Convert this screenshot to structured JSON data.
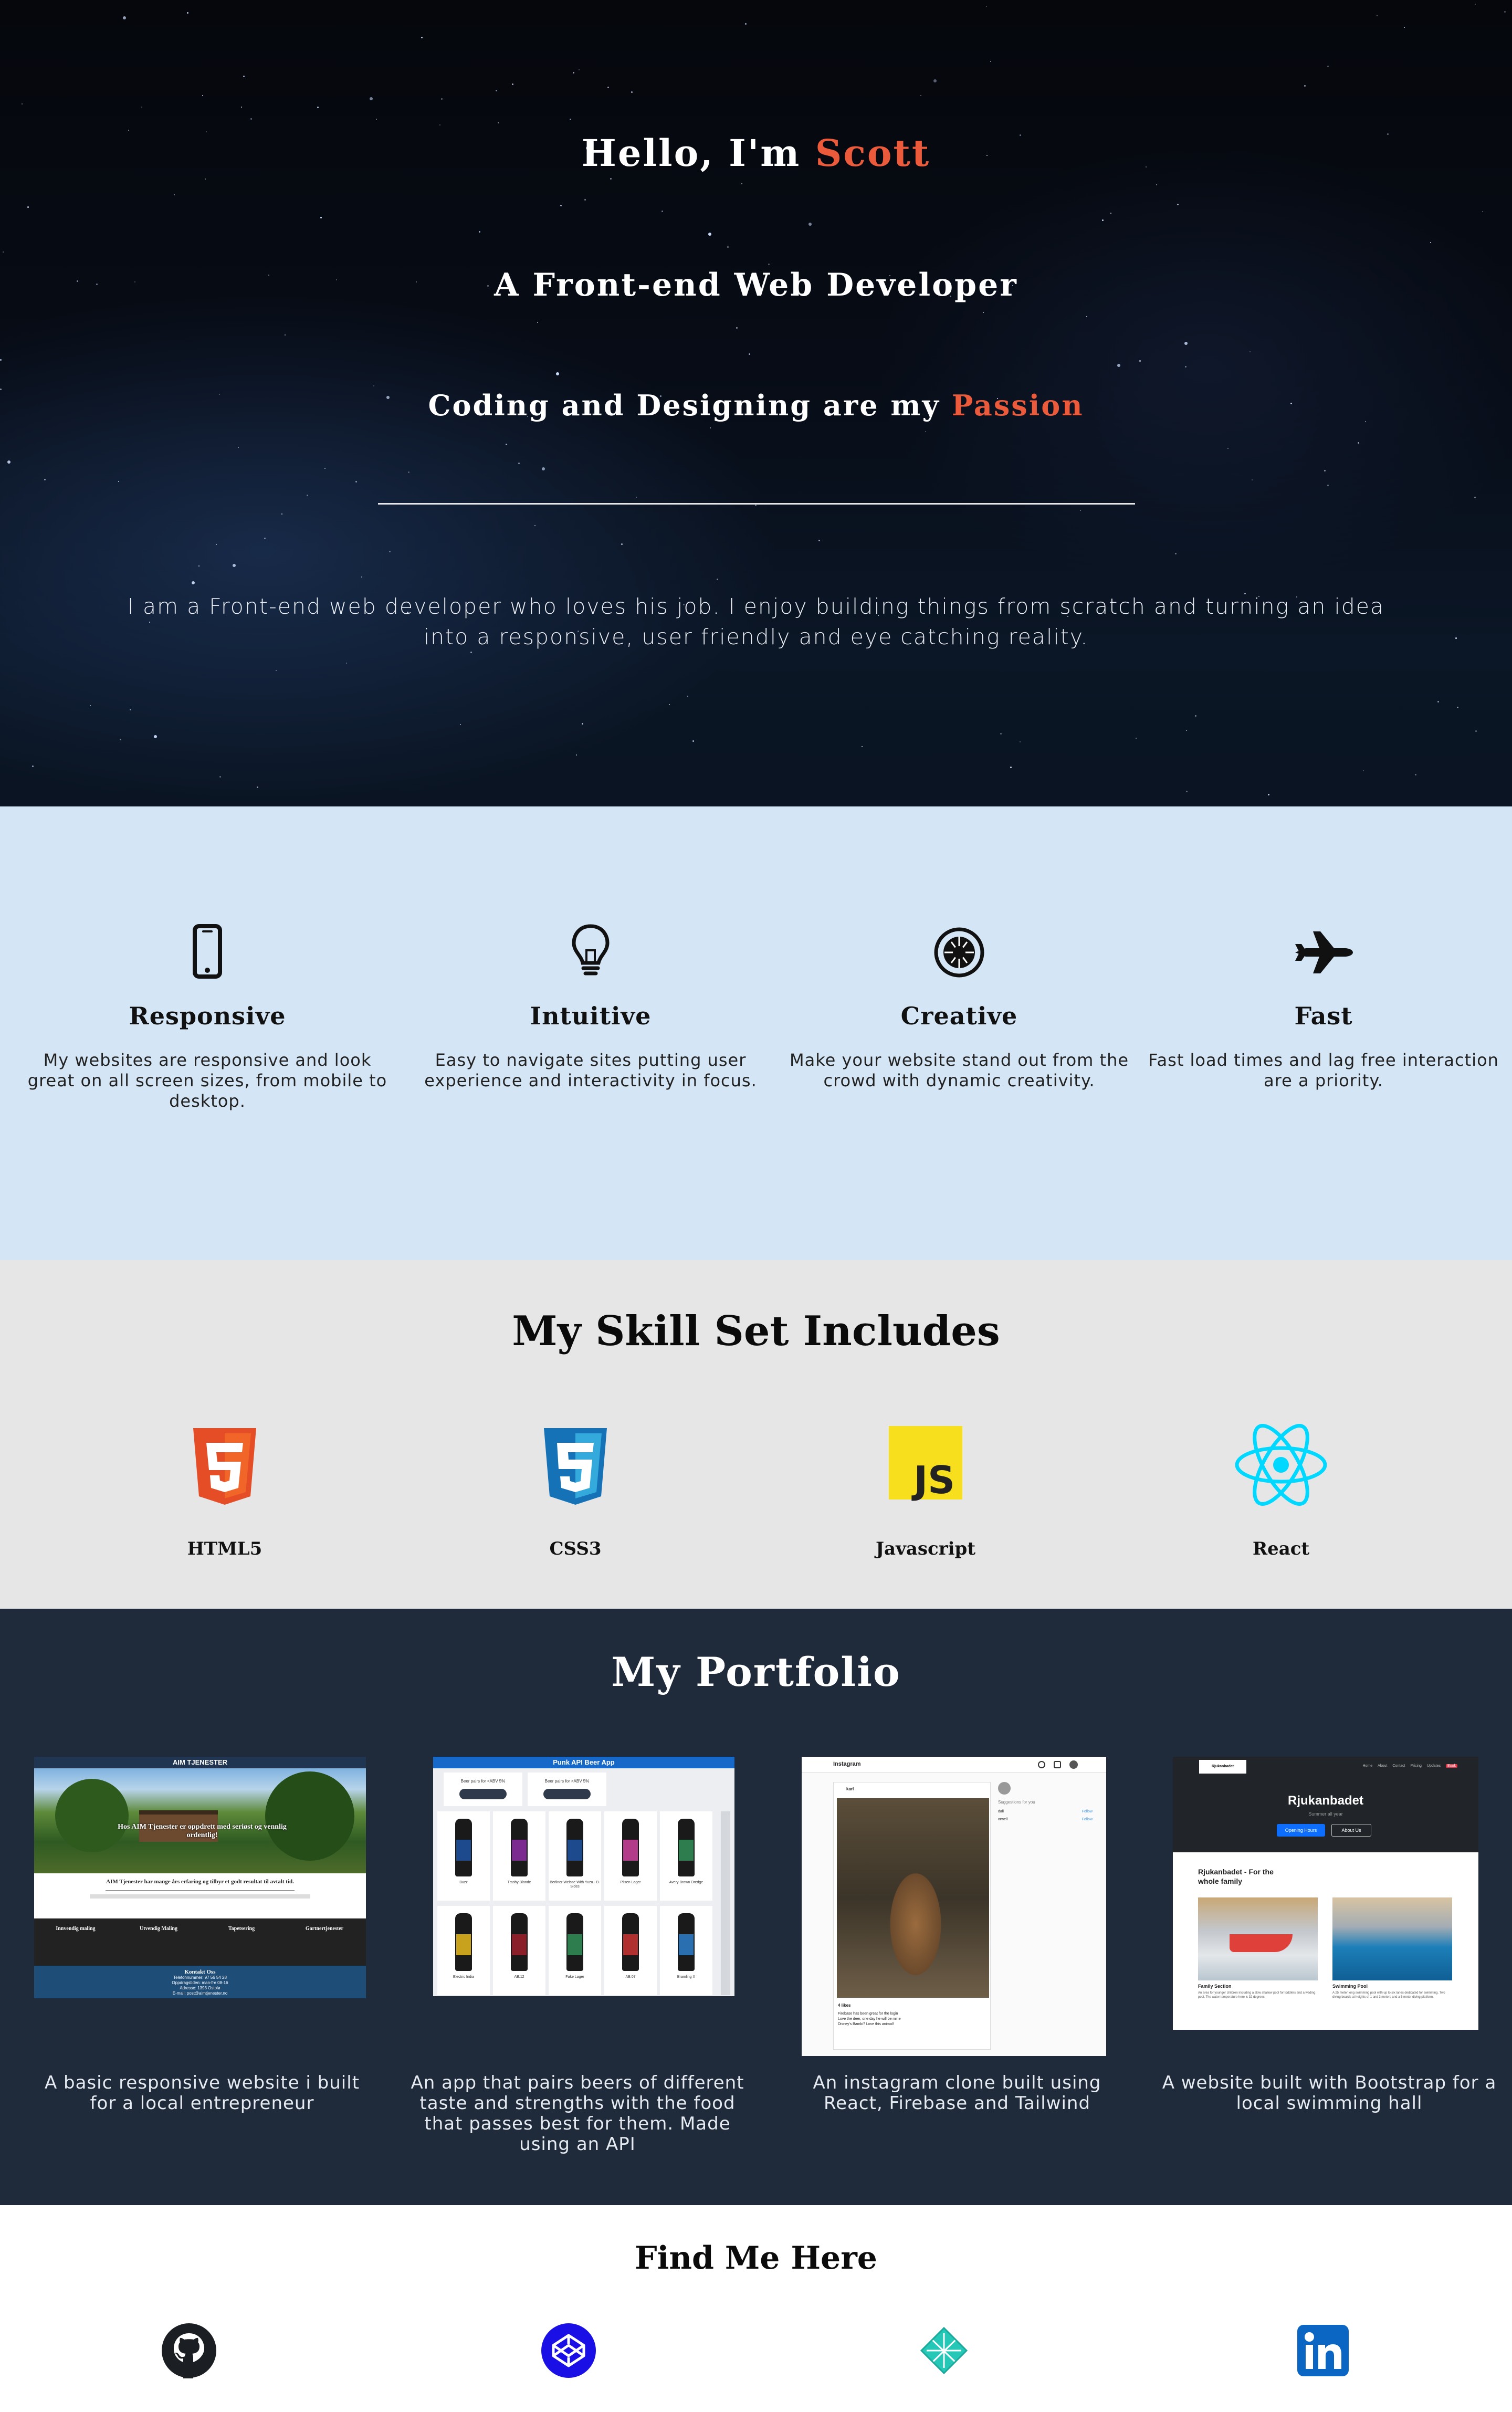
{
  "hero": {
    "greeting_prefix": "Hello, I'm ",
    "greeting_name": "Scott",
    "subtitle": "A Front-end Web Developer",
    "tagline_prefix": "Coding and Designing are my ",
    "tagline_accent": "Passion",
    "description": "I am a Front-end web developer who loves his job. I enjoy building things from scratch and turning an idea into a responsive, user friendly and eye catching reality.",
    "accent_color": "#ea5a3b"
  },
  "features": [
    {
      "icon": "phone-icon",
      "title": "Responsive",
      "text": "My websites are responsive and look great on all screen sizes, from mobile to desktop."
    },
    {
      "icon": "lightbulb-icon",
      "title": "Intuitive",
      "text": "Easy to navigate sites putting user experience and interactivity in focus."
    },
    {
      "icon": "creative-icon",
      "title": "Creative",
      "text": "Make your website stand out from the crowd with dynamic creativity."
    },
    {
      "icon": "jet-icon",
      "title": "Fast",
      "text": "Fast load times and lag free interaction are a priority."
    }
  ],
  "skills": {
    "title": "My Skill Set Includes",
    "items": [
      {
        "icon": "html5-icon",
        "label": "HTML5",
        "color": "#e44d26"
      },
      {
        "icon": "css3-icon",
        "label": "CSS3",
        "color": "#1572b6"
      },
      {
        "icon": "javascript-icon",
        "label": "Javascript",
        "color": "#f7df1e"
      },
      {
        "icon": "react-icon",
        "label": "React",
        "color": "#00d8ff"
      }
    ]
  },
  "portfolio": {
    "title": "My Portfolio",
    "projects": [
      {
        "caption": "A basic responsive website i built for a local entrepreneur",
        "shot": {
          "header": "AIM TJENESTER",
          "hero_text": "Hos AIM Tjenester er oppdrett med seriøst og vennlig ordentlig!",
          "intro_title": "AIM Tjenester har mange års erfaring og tilbyr et godt resultat til avtalt tid.",
          "columns": [
            "Innvendig maling",
            "Utvendig Maling",
            "Tapetsering",
            "Gartnertjenester"
          ],
          "contact_title": "Kontakt Oss",
          "contact_lines": [
            "Telefonnummer: 97 56 54 28",
            "Oppdragstiden: man-fre 08-16",
            "Adresse: 1393 Ostolø",
            "E-mail: post@aimtjenester.no"
          ]
        }
      },
      {
        "caption": "An app that pairs beers of different taste and strengths with the food that passes best for them. Made using an API",
        "shot": {
          "header": "Punk API Beer App",
          "filter_a": "Beer pairs for <ABV 5%",
          "filter_b": "Beer pairs for >ABV 5%",
          "beer_names": [
            "Buzz",
            "Trashy Blonde",
            "Berliner Weisse With Yuzu - B-Sides",
            "Pilsen Lager",
            "Avery Brown Dredge",
            "Electric India",
            "AB:12",
            "Fake Lager",
            "AB:07",
            "Bramling X"
          ]
        }
      },
      {
        "caption": "An instagram clone built using React, Firebase and Tailwind",
        "shot": {
          "brand": "Instagram",
          "user": "karl",
          "likes": "4 likes",
          "comment_a": "Firebase has been great for the login",
          "comment_b": "Love the deer, one day he will be mine",
          "comment_c": "Disney's Bambi? Love this animal!",
          "suggestions_title": "Suggestions for you",
          "suggest_users": [
            "dali",
            "orwell"
          ],
          "follow_label": "Follow"
        }
      },
      {
        "caption": "A website built with Bootstrap for a local swimming hall",
        "shot": {
          "logo": "Rjukanbadet",
          "nav": [
            "Home",
            "About",
            "Contact",
            "Pricing",
            "Updates",
            "Book"
          ],
          "hero_title": "Rjukanbadet",
          "hero_sub": "Summer all year",
          "btn_primary": "Opening Hours",
          "btn_secondary": "About Us",
          "section_title": "Rjukanbadet - For the whole family",
          "card_a_title": "Family Section",
          "card_a_text": "An area for younger children including a slow shallow pool for toddlers and a wading pool. The water temperature here is 32 degrees.",
          "card_b_title": "Swimming Pool",
          "card_b_text": "A 25 meter long swimming pool with up to six lanes dedicated for swimming. Two diving boards at heights of 1 and 3 meters and a 5 meter diving platform."
        }
      }
    ]
  },
  "find": {
    "title": "Find Me Here",
    "links": [
      {
        "icon": "github-icon",
        "color": "#1b1f23"
      },
      {
        "icon": "codepen-icon",
        "color": "#1a10e6"
      },
      {
        "icon": "netlify-icon",
        "color": "#25c7b7"
      },
      {
        "icon": "linkedin-icon",
        "color": "#0a66c2"
      }
    ]
  }
}
